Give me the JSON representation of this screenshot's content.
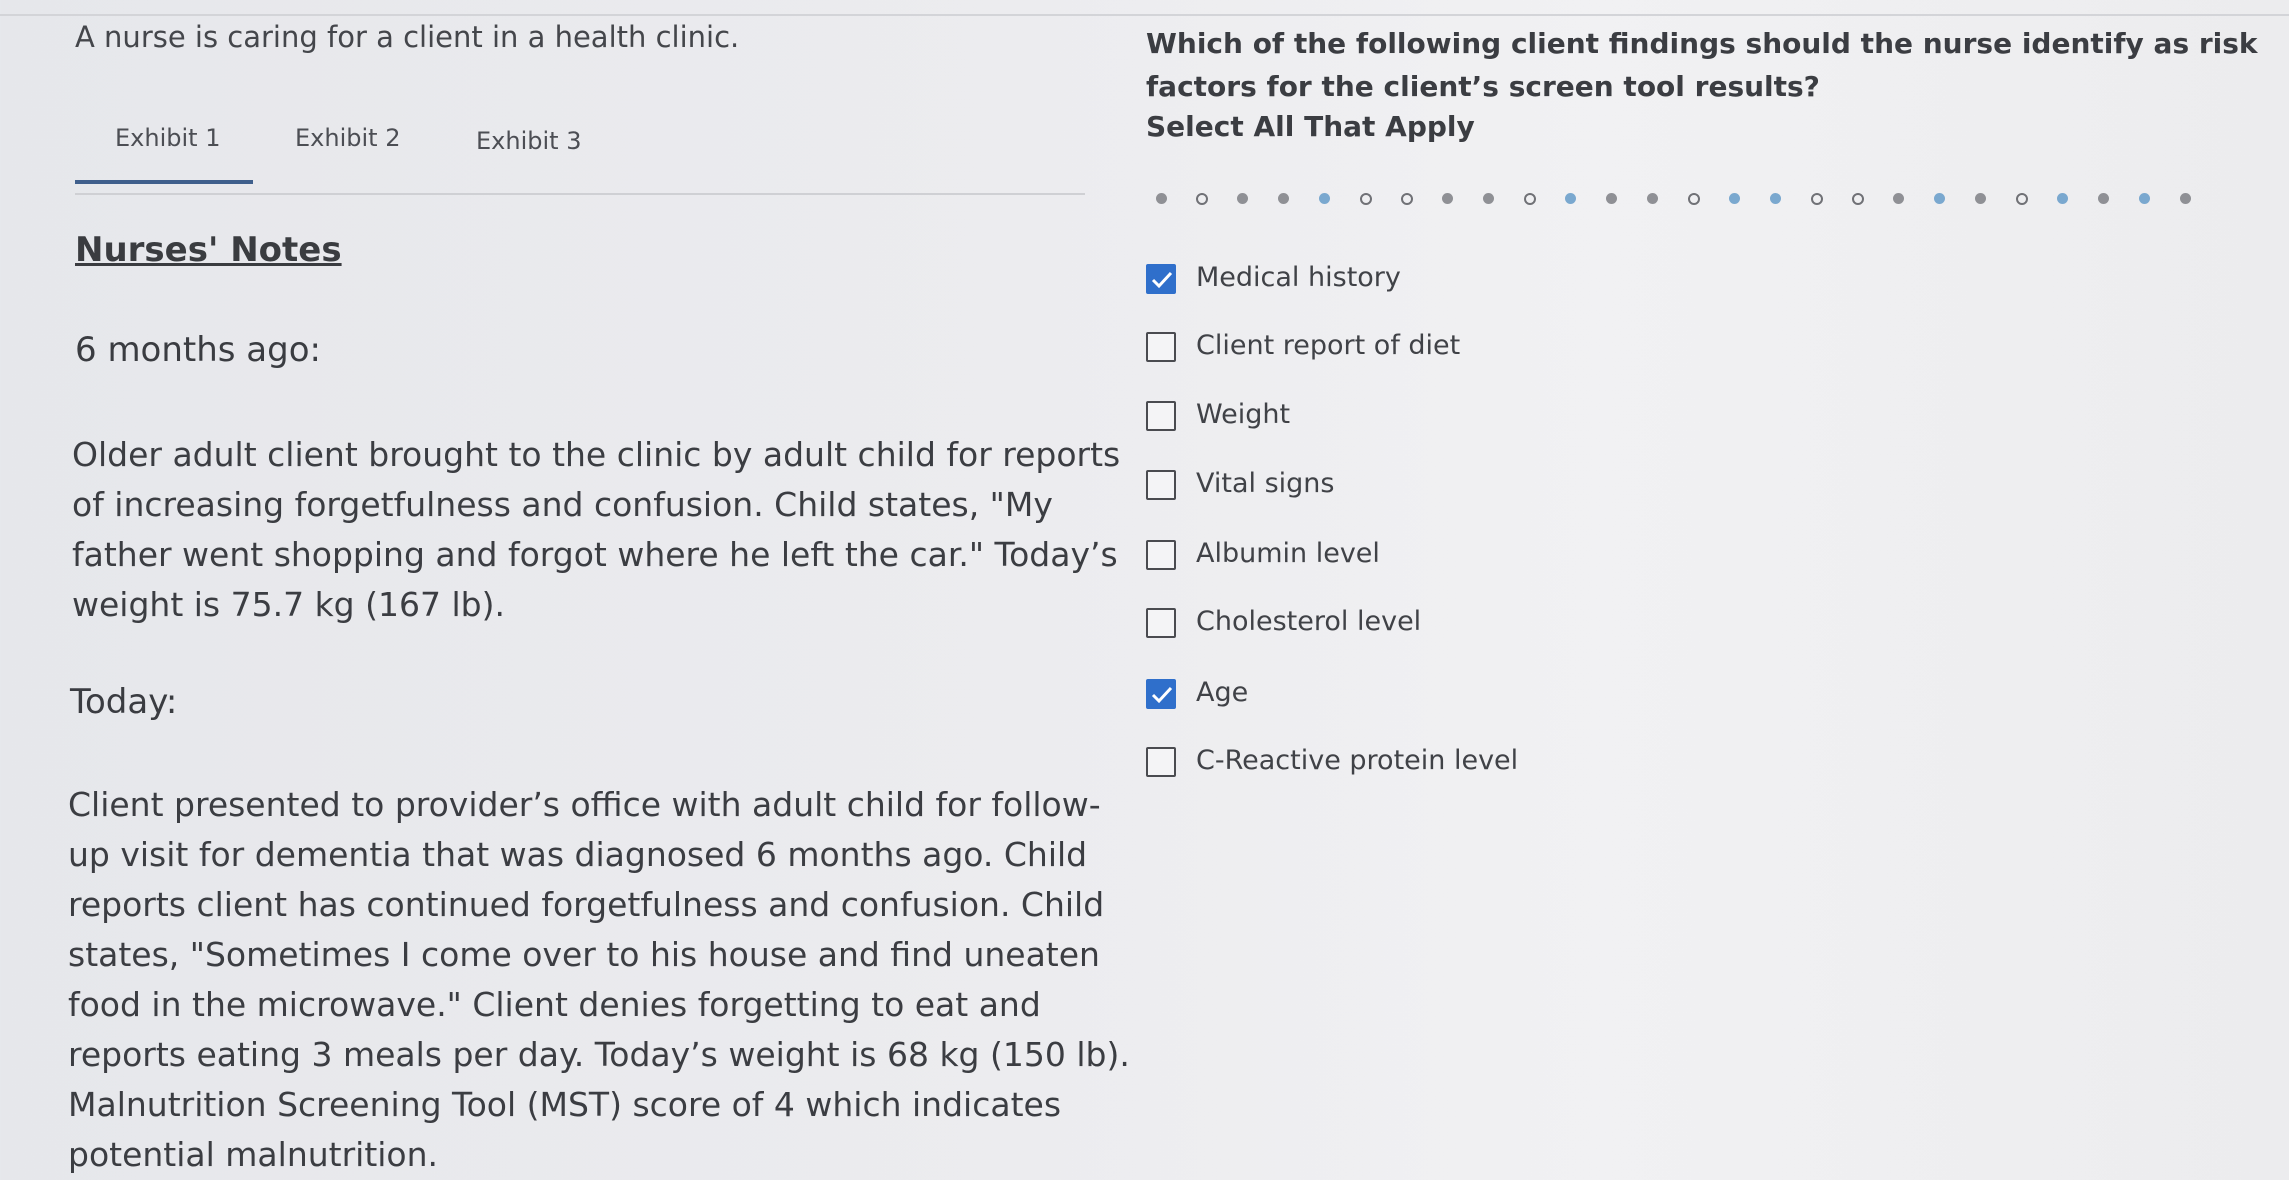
{
  "scenario": "A nurse is caring for a client in a health clinic.",
  "tabs": [
    {
      "label": "Exhibit 1",
      "active": true
    },
    {
      "label": "Exhibit 2",
      "active": false
    },
    {
      "label": "Exhibit 3",
      "active": false
    }
  ],
  "notes": {
    "title": "Nurses' Notes",
    "section1_label": "6 months ago:",
    "section1_lines": [
      "Older adult client brought to the clinic by adult child for reports",
      "of increasing forgetfulness and confusion. Child states, \"My",
      "father went shopping and forgot where he left the car.\" Today’s",
      "weight is 75.7 kg (167 lb)."
    ],
    "section2_label": "Today:",
    "section2_lines": [
      "Client presented to provider’s office with adult child for follow-",
      "up visit for dementia that was diagnosed 6 months ago. Child",
      "reports client has continued forgetfulness and confusion. Child",
      "states, \"Sometimes I come over to his house and find uneaten",
      "food in the microwave.\" Client denies forgetting to eat and",
      "reports eating 3 meals per day. Today’s weight is 68 kg (150 lb).",
      "Malnutrition Screening Tool (MST) score of 4 which indicates",
      "potential malnutrition."
    ]
  },
  "question": {
    "lines": [
      "Which of the following client findings should the nurse identify as risk",
      "factors for the client’s screen tool results?"
    ],
    "instruction": "Select All That Apply"
  },
  "options": [
    {
      "label": "Medical history",
      "checked": true
    },
    {
      "label": "Client report of diet",
      "checked": false
    },
    {
      "label": "Weight",
      "checked": false
    },
    {
      "label": "Vital signs",
      "checked": false
    },
    {
      "label": "Albumin level",
      "checked": false
    },
    {
      "label": "Cholesterol level",
      "checked": false
    },
    {
      "label": "Age",
      "checked": true
    },
    {
      "label": "C-Reactive protein level",
      "checked": false
    }
  ],
  "colors": {
    "accent": "#2f6fcb",
    "tab_underline": "#3f5f8c",
    "text": "#3b3d42"
  }
}
